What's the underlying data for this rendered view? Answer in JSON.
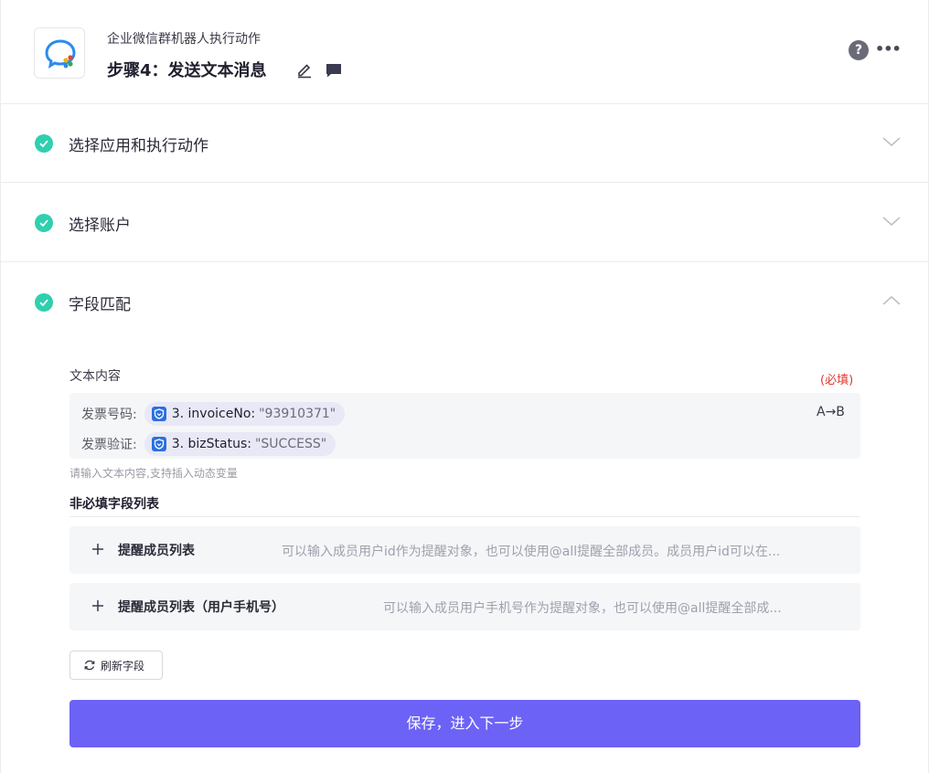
{
  "header": {
    "app_name": "企业微信群机器人执行动作",
    "step_title": "步骤4：发送文本消息",
    "help_glyph": "?",
    "more_glyph": "•••"
  },
  "sections": [
    {
      "label": "选择应用和执行动作",
      "status": "done",
      "expanded": false
    },
    {
      "label": "选择账户",
      "status": "done",
      "expanded": false
    },
    {
      "label": "字段匹配",
      "status": "done",
      "expanded": true
    }
  ],
  "field": {
    "label": "文本内容",
    "required_text": "(必填)",
    "rows": [
      {
        "label": "发票号码:",
        "chip_key": "3. invoiceNo:",
        "chip_value": "\"93910371\""
      },
      {
        "label": "发票验证:",
        "chip_key": "3. bizStatus:",
        "chip_value": "\"SUCCESS\""
      }
    ],
    "transform_text": "A→B",
    "hint": "请输入文本内容,支持插入动态变量"
  },
  "optional": {
    "title": "非必填字段列表",
    "items": [
      {
        "label": "提醒成员列表",
        "description": "可以输入成员用户id作为提醒对象，也可以使用@all提醒全部成员。成员用户id可以在..."
      },
      {
        "label": "提醒成员列表（用户手机号）",
        "description": "可以输入成员用户手机号作为提醒对象，也可以使用@all提醒全部成..."
      }
    ]
  },
  "actions": {
    "refresh_label": "刷新字段",
    "save_label": "保存，进入下一步"
  },
  "colors": {
    "accent": "#6c62f6",
    "success": "#2fcfaf",
    "required": "#e5372e"
  }
}
